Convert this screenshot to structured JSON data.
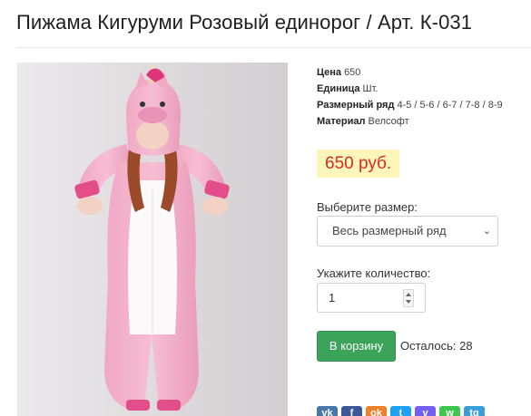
{
  "page": {
    "title": "Пижама Кигуруми Розовый единорог / Арт. К-031"
  },
  "product_image": {
    "alt": "Пижама Кигуруми Розовый единорог"
  },
  "specs": [
    {
      "key": "Цена",
      "value": "650"
    },
    {
      "key": "Единица",
      "value": "Шт."
    },
    {
      "key": "Размерный ряд",
      "value": "4-5 / 5-6 / 6-7 / 7-8 / 8-9"
    },
    {
      "key": "Материал",
      "value": "Велсофт"
    }
  ],
  "price": "650 руб.",
  "size": {
    "label": "Выберите размер:",
    "selected": "Весь размерный ряд"
  },
  "quantity": {
    "label": "Укажите количество:",
    "value": "1"
  },
  "cart": {
    "button_label": "В корзину",
    "stock_text": "Осталось: 28"
  },
  "share": {
    "buttons": [
      {
        "icon": "vk-icon",
        "color": "#4a76a8",
        "glyph": "vk"
      },
      {
        "icon": "facebook-icon",
        "color": "#3b5998",
        "glyph": "f"
      },
      {
        "icon": "odnoklassniki-icon",
        "color": "#ed812b",
        "glyph": "ok"
      },
      {
        "icon": "twitter-icon",
        "color": "#1da1f2",
        "glyph": "t"
      },
      {
        "icon": "viber-icon",
        "color": "#7360f2",
        "glyph": "v"
      },
      {
        "icon": "whatsapp-icon",
        "color": "#3ec64e",
        "glyph": "w"
      },
      {
        "icon": "telegram-icon",
        "color": "#3a9ed8",
        "glyph": "tg"
      }
    ]
  },
  "colors": {
    "price_text": "#d42c2c",
    "price_bg": "#fdf6b8",
    "cart_button": "#3ca35a"
  }
}
